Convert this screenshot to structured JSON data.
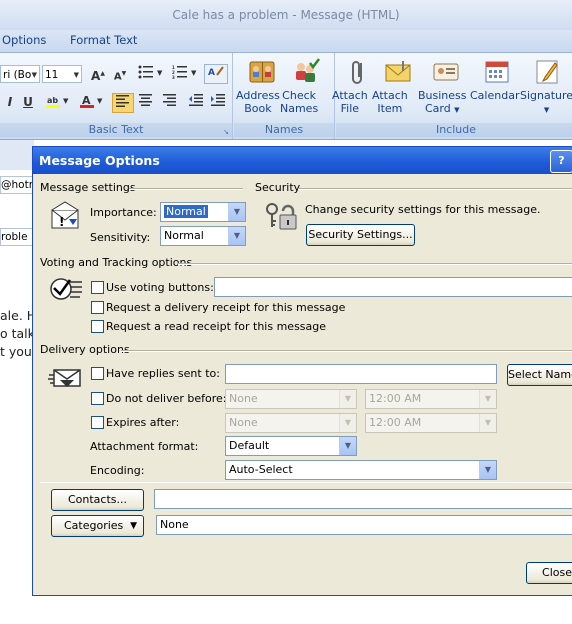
{
  "window": {
    "title": "Cale has a problem - Message (HTML)"
  },
  "ribbon": {
    "tabs": [
      "Options",
      "Format Text"
    ],
    "font_name": "ri (Bo",
    "font_size": "11",
    "basic_text_label": "Basic Text",
    "names_label": "Names",
    "include_label": "Include",
    "address_book": "Address\nBook",
    "address_book_l1": "Address",
    "address_book_l2": "Book",
    "check_names_l1": "Check",
    "check_names_l2": "Names",
    "attach_file_l1": "Attach",
    "attach_file_l2": "File",
    "attach_item_l1": "Attach",
    "attach_item_l2": "Item",
    "business_card_l1": "Business",
    "business_card_l2": "Card",
    "calendar": "Calendar",
    "signature": "Signature"
  },
  "background": {
    "to_field": "@hotm",
    "subject_field": "roble",
    "body_lines": [
      "ale. H",
      "o talk",
      "t you"
    ]
  },
  "dialog": {
    "title": "Message Options",
    "help": "?",
    "message_settings": {
      "header": "Message settings",
      "importance_label": "Importance:",
      "importance_value": "Normal",
      "sensitivity_label": "Sensitivity:",
      "sensitivity_value": "Normal"
    },
    "security": {
      "header": "Security",
      "description": "Change security settings for this message.",
      "button": "Security Settings..."
    },
    "voting": {
      "header": "Voting and Tracking options",
      "use_voting": "Use voting buttons:",
      "delivery_receipt": "Request a delivery receipt for this message",
      "read_receipt": "Request a read receipt for this message"
    },
    "delivery": {
      "header": "Delivery options",
      "have_replies": "Have replies sent to:",
      "select_names": "Select Names...",
      "do_not_deliver": "Do not deliver before:",
      "do_not_deliver_date": "None",
      "do_not_deliver_time": "12:00 AM",
      "expires_after": "Expires after:",
      "expires_date": "None",
      "expires_time": "12:00 AM",
      "attachment_format_label": "Attachment format:",
      "attachment_format_value": "Default",
      "encoding_label": "Encoding:",
      "encoding_value": "Auto-Select"
    },
    "contacts_button": "Contacts...",
    "categories_button": "Categories",
    "categories_value": "None",
    "close_button": "Close"
  },
  "colors": {
    "dialog_title": "#1e5ad8",
    "dialog_body": "#ece9d8",
    "ribbon_text": "#15428b"
  }
}
